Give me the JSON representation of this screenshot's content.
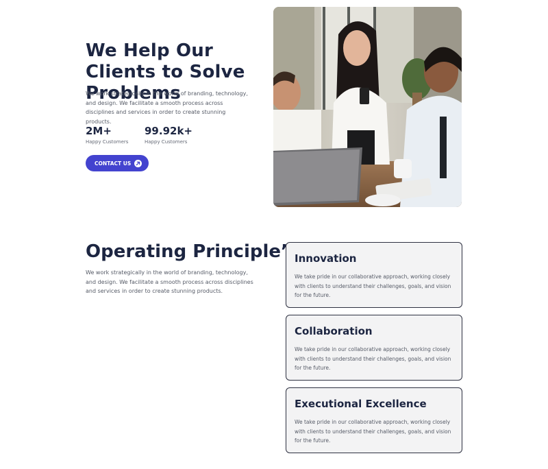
{
  "hero": {
    "title": "We Help Our Clients to Solve Problems",
    "description": "We work strategically in the world of branding, technology, and design. We facilitate a smooth process across disciplines and services in order to create stunning products.",
    "stats": [
      {
        "value": "2M+",
        "label": "Happy Customers"
      },
      {
        "value": "99.92k+",
        "label": "Happy Customers"
      }
    ],
    "cta": {
      "label": "CONTACT US",
      "icon": "arrow-up-right-icon"
    },
    "photo": {
      "subject": "team-meeting-photo"
    }
  },
  "principles": {
    "title": "Operating Principle’s",
    "description": "We work strategically in the world of branding, technology, and design. We facilitate a smooth process across disciplines and services in order to create stunning products.",
    "cards": [
      {
        "title": "Innovation",
        "text": "We take pride in our collaborative approach, working closely with clients to understand their challenges, goals, and vision for the future."
      },
      {
        "title": "Collaboration",
        "text": "We take pride in our collaborative approach, working closely with clients to understand their challenges, goals, and vision for the future."
      },
      {
        "title": "Executional Excellence",
        "text": "We take pride in our collaborative approach, working closely with clients to understand their challenges, goals, and vision for the future."
      }
    ]
  },
  "colors": {
    "heading": "#1c2541",
    "body_text": "#555a66",
    "accent": "#4343cf",
    "card_background": "#f3f3f4",
    "card_border": "#2d3040"
  }
}
